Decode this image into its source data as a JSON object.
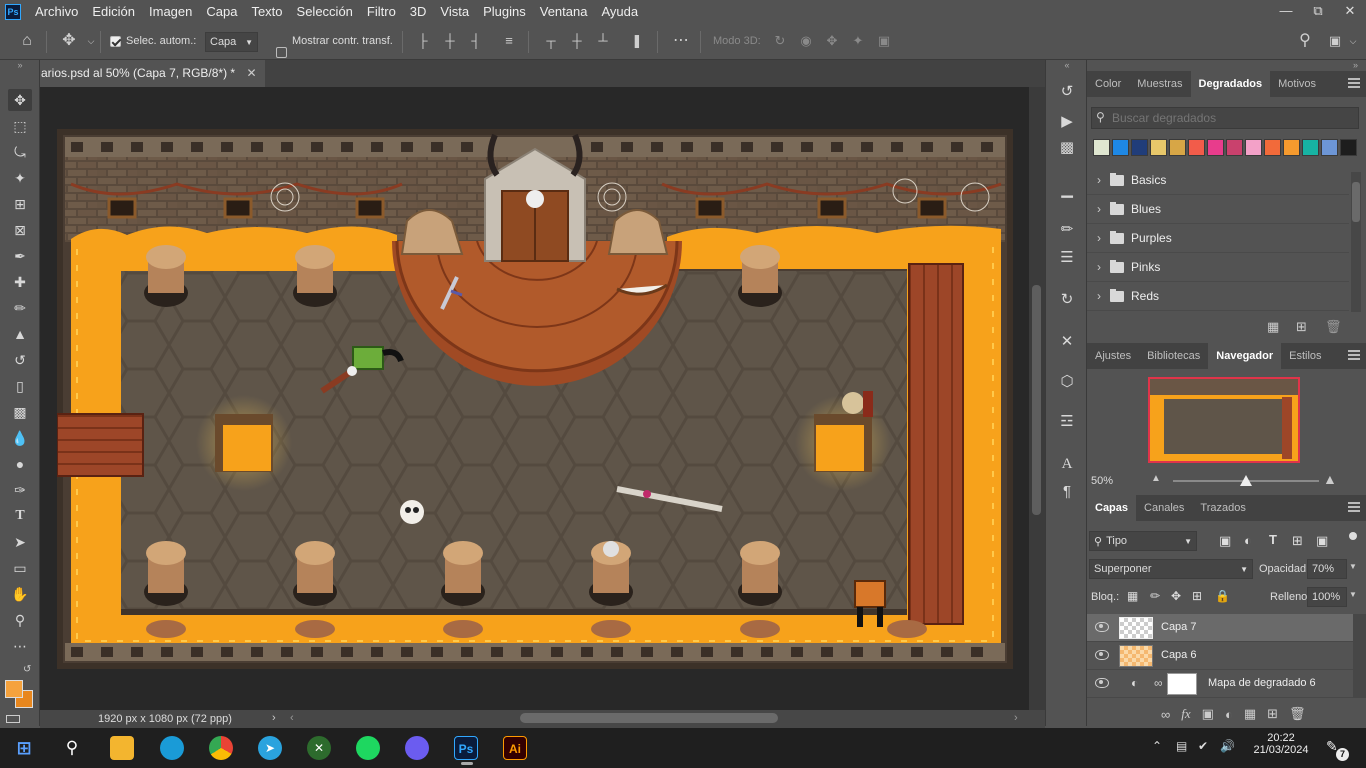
{
  "app": {
    "logo": "Ps"
  },
  "menu": [
    "Archivo",
    "Edición",
    "Imagen",
    "Capa",
    "Texto",
    "Selección",
    "Filtro",
    "3D",
    "Vista",
    "Plugins",
    "Ventana",
    "Ayuda"
  ],
  "options": {
    "auto_select_label": "Selec. autom.:",
    "auto_select_value": "Capa",
    "show_transform_label": "Mostrar contr. transf.",
    "mode3d_label": "Modo 3D:"
  },
  "document": {
    "tab_title": "arios.psd al 50% (Capa 7, RGB/8*) *",
    "status": "1920 px x 1080 px (72 ppp)"
  },
  "panel_top": {
    "tabs": [
      "Color",
      "Muestras",
      "Degradados",
      "Motivos"
    ],
    "active_tab": "Degradados",
    "search_placeholder": "Buscar degradados",
    "swatches": [
      "#dfe6d0",
      "#1e88e5",
      "#203d7a",
      "#e8c86a",
      "#d7a646",
      "#f25c4a",
      "#e83c8c",
      "#c9416d",
      "#f3a1c8",
      "#f26a3a",
      "#f59a2e",
      "#17b3a3",
      "#6d96d6",
      "#1d1d1d"
    ],
    "folders": [
      "Basics",
      "Blues",
      "Purples",
      "Pinks",
      "Reds"
    ]
  },
  "panel_mid": {
    "tabs": [
      "Ajustes",
      "Bibliotecas",
      "Navegador",
      "Estilos"
    ],
    "active_tab": "Navegador",
    "zoom": "50%",
    "zoom_fraction": 0.5
  },
  "panel_layers": {
    "tabs": [
      "Capas",
      "Canales",
      "Trazados"
    ],
    "active_tab": "Capas",
    "filter_value": "Tipo",
    "blend_mode": "Superponer",
    "opacity_label": "Opacidad:",
    "opacity_value": "70%",
    "lock_label": "Bloq.:",
    "fill_label": "Relleno:",
    "fill_value": "100%",
    "layers": [
      {
        "name": "Capa 7",
        "selected": true
      },
      {
        "name": "Capa 6",
        "selected": false
      },
      {
        "name": "Mapa de degradado 6",
        "selected": false
      }
    ]
  },
  "taskbar": {
    "time": "20:22",
    "date": "21/03/2024",
    "notifications": "7",
    "apps": [
      "start",
      "search",
      "explorer",
      "edge",
      "chrome",
      "telegram",
      "xbox",
      "spotify",
      "discord",
      "photoshop",
      "illustrator"
    ]
  },
  "colors": {
    "fg": "#f5a23d",
    "bg": "#e8871e",
    "lava": "#f7a21b",
    "floor": "#5e5448"
  }
}
